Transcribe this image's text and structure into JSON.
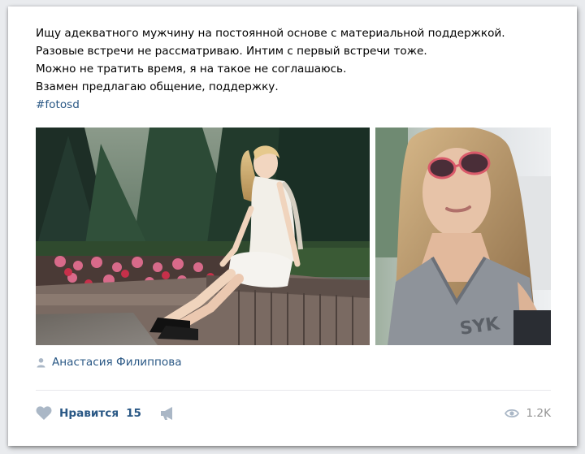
{
  "post": {
    "lines": [
      "Ищу адекватного мужчину на постоянной основе с материальной поддержкой.",
      "Разовые встречи не рассматриваю. Интим с первый встречи тоже.",
      "Можно не тратить время, я на такое не соглашаюсь.",
      "Взамен предлагаю общение, поддержку."
    ],
    "hashtag": "#fotosd"
  },
  "author": {
    "name": "Анастасия Филиппова",
    "icon": "person-icon"
  },
  "footer": {
    "like_label": "Нравится",
    "like_count": "15",
    "views": "1.2K",
    "icons": [
      "heart-icon",
      "megaphone-icon",
      "eye-icon"
    ]
  },
  "colors": {
    "link": "#2a5885",
    "icon_gray": "#aab7c6",
    "muted": "#939393",
    "background": "#e9ebee"
  }
}
